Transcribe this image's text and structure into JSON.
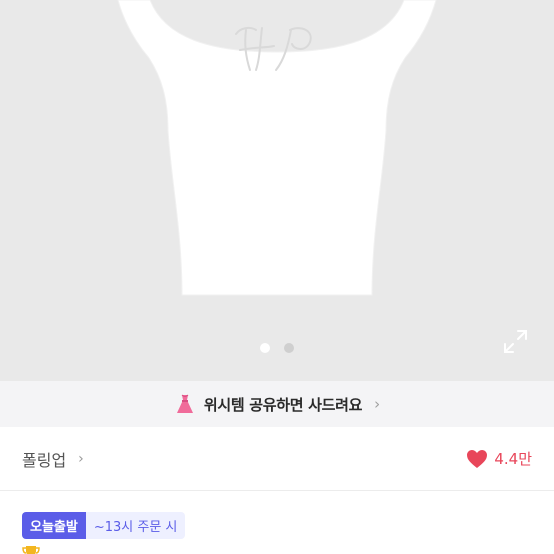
{
  "product_image": {
    "dots_total": 2,
    "active_dot": 1,
    "expand_icon": "expand-icon"
  },
  "share_banner": {
    "icon": "dress-icon",
    "label": "위시템 공유하면 사드려요",
    "chevron": "›"
  },
  "seller": {
    "name": "폴링업",
    "chevron": "›",
    "likes_icon": "heart-icon",
    "likes_count": "4.4만"
  },
  "badges": {
    "today_shipping": "오늘출발",
    "order_deadline": "~13시 주문 시"
  },
  "title": {
    "icon": "trophy-icon",
    "text": ""
  },
  "colors": {
    "badge_accent": "#5b5de8",
    "heart": "#e8465a",
    "dress": "#f06b9a"
  }
}
